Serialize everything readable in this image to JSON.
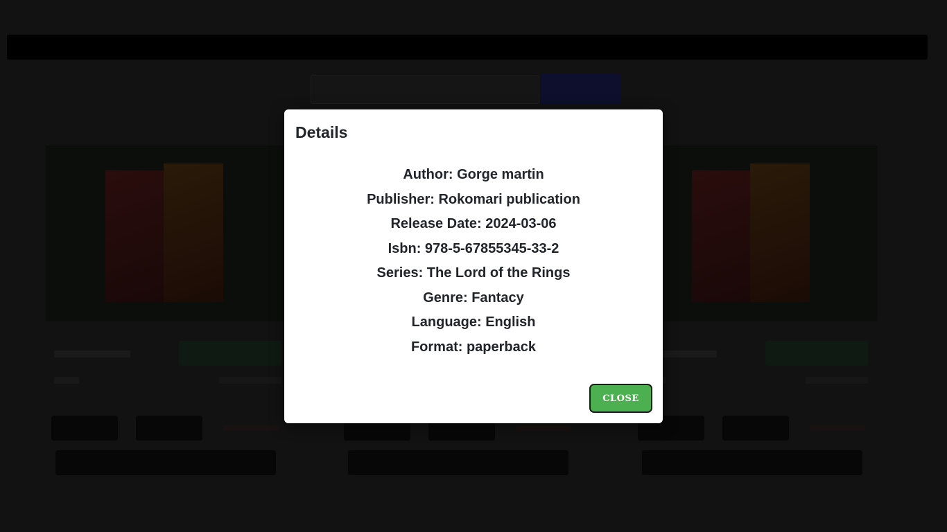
{
  "modal": {
    "title": "Details",
    "fields": {
      "author": "Author: Gorge martin",
      "publisher": "Publisher: Rokomari publication",
      "release_date": "Release Date: 2024-03-06",
      "isbn": "Isbn: 978-5-67855345-33-2",
      "series": "Series: The Lord of the Rings",
      "genre": "Genre: Fantacy",
      "language": "Language: English",
      "format": "Format: paperback"
    },
    "close_label": "CLOSE"
  },
  "colors": {
    "close_button": "#4caf50",
    "page_background": "#121212",
    "modal_background": "#ffffff",
    "text": "#212529"
  }
}
